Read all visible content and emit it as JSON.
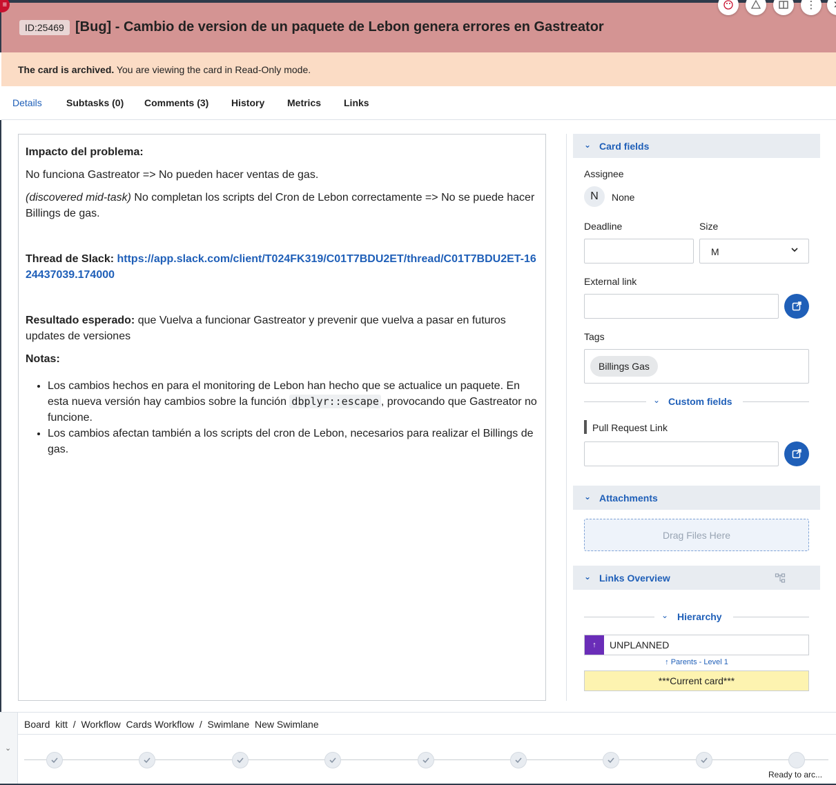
{
  "header": {
    "id_label": "ID:25469",
    "title": "[Bug] - Cambio de version de un paquete de Lebon genera errores en Gastreator",
    "icons": [
      "palette-icon",
      "warning-icon",
      "layout-icon",
      "more-vertical-icon",
      "close-icon"
    ],
    "color": "#d49493"
  },
  "archived_banner": {
    "bold": "The card is archived.",
    "text": " You are viewing the card in Read-Only mode."
  },
  "tabs": [
    {
      "label": "Details"
    },
    {
      "label": "Subtasks (0)"
    },
    {
      "label": "Comments (3)"
    },
    {
      "label": "History"
    },
    {
      "label": "Metrics"
    },
    {
      "label": "Links"
    }
  ],
  "description": {
    "impact_heading": "Impacto del problema:",
    "impact_line": "No funciona Gastreator => No pueden hacer ventas de gas.",
    "discovered_italic": "(discovered mid-task)",
    "discovered_text": " No completan los scripts del Cron de Lebon correctamente => No se puede hacer Billings de gas.",
    "slack_label": "Thread de Slack: ",
    "slack_url": "https://app.slack.com/client/T024FK319/C01T7BDU2ET/thread/C01T7BDU2ET-1624437039.174000",
    "result_label": "Resultado esperado:",
    "result_text": " que Vuelva a funcionar Gastreator y prevenir que vuelva a pasar en futuros updates de versiones",
    "notes_heading": "Notas:",
    "bullet1_a": "Los cambios hechos en para el monitoring de Lebon han hecho que se actualice un paquete. En esta nueva versión hay cambios sobre la función ",
    "bullet1_code": "dbplyr::escape",
    "bullet1_b": ", provocando que Gastreator no funcione.",
    "bullet2": "Los cambios afectan también a los scripts del cron de Lebon, necesarios para realizar el Billings de gas."
  },
  "card_fields": {
    "title": "Card fields",
    "assignee_label": "Assignee",
    "assignee_initial": "N",
    "assignee_value": "None",
    "deadline_label": "Deadline",
    "deadline_value": "",
    "size_label": "Size",
    "size_value": "M",
    "external_link_label": "External link",
    "external_link_value": "",
    "tags_label": "Tags",
    "tags": [
      "Billings Gas"
    ],
    "custom_fields_label": "Custom fields",
    "pull_request_label": "Pull Request Link",
    "pull_request_value": ""
  },
  "attachments": {
    "title": "Attachments",
    "dropzone_text": "Drag Files Here"
  },
  "links_overview": {
    "title": "Links Overview",
    "hierarchy_label": "Hierarchy",
    "parent_badge": "↑",
    "parent_name": "UNPLANNED",
    "parents_level": "↑ Parents - Level 1",
    "current_card": "***Current card***"
  },
  "footer": {
    "breadcrumb": "Board  kitt  /  Workflow  Cards Workflow  /  Swimlane  New Swimlane",
    "last_step_label": "Ready to arc...",
    "steps_completed": 8,
    "steps_total": 9
  },
  "colors": {
    "accent": "#1f5fb8",
    "archived_banner": "#fbdcc5",
    "current_card": "#fdf3b0",
    "parent_badge": "#6a2db8"
  }
}
